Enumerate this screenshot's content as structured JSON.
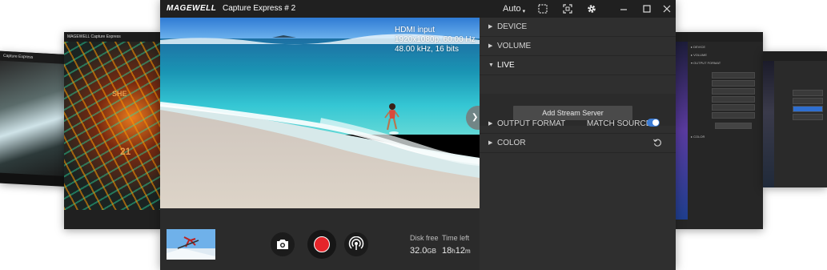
{
  "app": {
    "brand": "MAGEWELL",
    "title": "Capture Express  # 2",
    "quality": "Auto"
  },
  "background_windows": {
    "left1_title": "Capture Express",
    "left2_title": "MAGEWELL  Capture Express"
  },
  "preview": {
    "signal_lines": [
      "HDMI input",
      "1920x1080p, 60.00 Hz",
      "48.00 kHz, 16 bits"
    ]
  },
  "stats": {
    "disk_free_label": "Disk free",
    "disk_free_value": "32.0",
    "disk_free_unit": "GB",
    "time_left_label": "Time left",
    "time_left_hours": "18",
    "time_left_h_unit": "h",
    "time_left_minutes": "12",
    "time_left_m_unit": "m"
  },
  "settings": {
    "sections": {
      "device": "DEVICE",
      "volume": "VOLUME",
      "live": "LIVE",
      "output_format": "OUTPUT FORMAT",
      "color": "COLOR"
    },
    "add_stream_label": "Add Stream Server",
    "match_source_label": "MATCH SOURCE",
    "match_source_on": true
  },
  "colors": {
    "accent": "#3a7bd5",
    "record": "#e5252a",
    "panel": "#2f2f2f",
    "titlebar": "#202020"
  },
  "icons": [
    "fullscreen-window-icon",
    "fullscreen-icon",
    "gear-icon",
    "minimize-icon",
    "maximize-icon",
    "close-icon",
    "camera-icon",
    "record-icon",
    "broadcast-icon",
    "reset-icon",
    "chevron-left-icon"
  ]
}
